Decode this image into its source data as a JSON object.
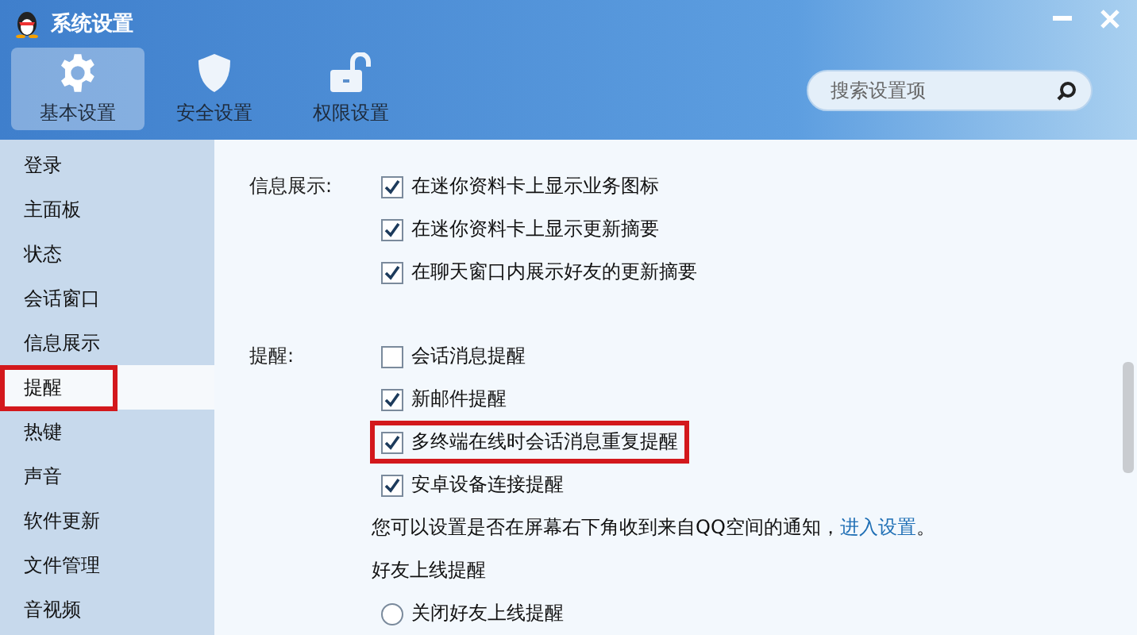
{
  "window": {
    "title": "系统设置"
  },
  "tabs": [
    {
      "label": "基本设置",
      "kind": "gear",
      "selected": true
    },
    {
      "label": "安全设置",
      "kind": "shield",
      "selected": false
    },
    {
      "label": "权限设置",
      "kind": "lock",
      "selected": false
    }
  ],
  "search": {
    "placeholder": "搜索设置项"
  },
  "sidebar": {
    "items": [
      {
        "label": "登录",
        "selected": false,
        "highlighted": false
      },
      {
        "label": "主面板",
        "selected": false,
        "highlighted": false
      },
      {
        "label": "状态",
        "selected": false,
        "highlighted": false
      },
      {
        "label": "会话窗口",
        "selected": false,
        "highlighted": false
      },
      {
        "label": "信息展示",
        "selected": false,
        "highlighted": false
      },
      {
        "label": "提醒",
        "selected": true,
        "highlighted": true
      },
      {
        "label": "热键",
        "selected": false,
        "highlighted": false
      },
      {
        "label": "声音",
        "selected": false,
        "highlighted": false
      },
      {
        "label": "软件更新",
        "selected": false,
        "highlighted": false
      },
      {
        "label": "文件管理",
        "selected": false,
        "highlighted": false
      },
      {
        "label": "音视频",
        "selected": false,
        "highlighted": false
      }
    ]
  },
  "sections": [
    {
      "label": "信息展示:",
      "options": [
        {
          "kind": "checkbox",
          "label": "在迷你资料卡上显示业务图标",
          "checked": true,
          "highlighted": false
        },
        {
          "kind": "checkbox",
          "label": "在迷你资料卡上显示更新摘要",
          "checked": true,
          "highlighted": false
        },
        {
          "kind": "checkbox",
          "label": "在聊天窗口内展示好友的更新摘要",
          "checked": true,
          "highlighted": false
        }
      ]
    },
    {
      "label": "提醒:",
      "options": [
        {
          "kind": "checkbox",
          "label": "会话消息提醒",
          "checked": false,
          "highlighted": false
        },
        {
          "kind": "checkbox",
          "label": "新邮件提醒",
          "checked": true,
          "highlighted": false
        },
        {
          "kind": "checkbox",
          "label": "多终端在线时会话消息重复提醒",
          "checked": true,
          "highlighted": true
        },
        {
          "kind": "checkbox",
          "label": "安卓设备连接提醒",
          "checked": true,
          "highlighted": false
        },
        {
          "kind": "note",
          "label": "您可以设置是否在屏幕右下角收到来自QQ空间的通知，",
          "link": "进入设置",
          "tail": "。"
        },
        {
          "kind": "heading",
          "label": "好友上线提醒"
        },
        {
          "kind": "radio",
          "label": "关闭好友上线提醒",
          "checked": false
        }
      ]
    }
  ]
}
